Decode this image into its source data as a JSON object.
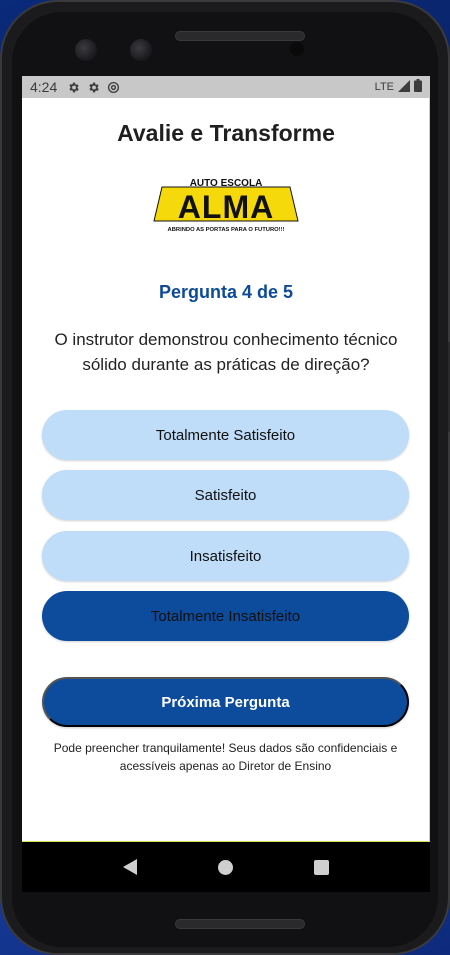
{
  "status_bar": {
    "time": "4:24",
    "network": "LTE"
  },
  "app": {
    "title": "Avalie e Transforme"
  },
  "logo": {
    "line1": "AUTO ESCOLA",
    "name": "ALMA",
    "tagline": "ABRINDO AS PORTAS PARA O FUTURO!!!"
  },
  "question": {
    "counter": "Pergunta 4 de 5",
    "text": "O instrutor demonstrou conhecimento técnico sólido durante as práticas de direção?"
  },
  "options": [
    {
      "label": "Totalmente Satisfeito",
      "selected": false
    },
    {
      "label": "Satisfeito",
      "selected": false
    },
    {
      "label": "Insatisfeito",
      "selected": false
    },
    {
      "label": "Totalmente Insatisfeito",
      "selected": true
    }
  ],
  "next_button": {
    "label": "Próxima Pergunta"
  },
  "footer": {
    "note": "Pode preencher tranquilamente! Seus dados são confidenciais e acessíveis apenas ao Diretor de Ensino"
  },
  "colors": {
    "primary": "#0d4b9c",
    "option_light": "#bfddf8",
    "logo_yellow": "#f5d90a"
  }
}
